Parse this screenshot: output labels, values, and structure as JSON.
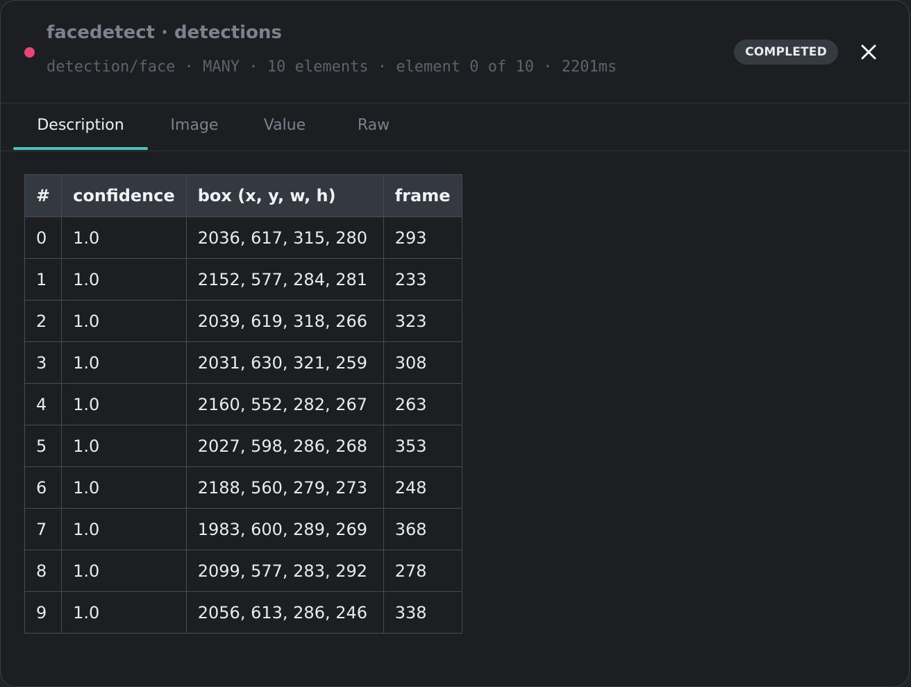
{
  "header": {
    "title": "facedetect · detections",
    "subtitle": "detection/face · MANY · 10 elements · element 0 of 10 · 2201ms",
    "status_badge": "COMPLETED",
    "status_dot_color": "#ea4577",
    "close_icon": "close-icon"
  },
  "tabs": [
    {
      "label": "Description",
      "active": true
    },
    {
      "label": "Image",
      "active": false
    },
    {
      "label": "Value",
      "active": false
    },
    {
      "label": "Raw",
      "active": false
    }
  ],
  "table": {
    "columns": [
      "#",
      "confidence",
      "box (x, y, w, h)",
      "frame"
    ],
    "rows": [
      [
        "0",
        "1.0",
        "2036, 617, 315, 280",
        "293"
      ],
      [
        "1",
        "1.0",
        "2152, 577, 284, 281",
        "233"
      ],
      [
        "2",
        "1.0",
        "2039, 619, 318, 266",
        "323"
      ],
      [
        "3",
        "1.0",
        "2031, 630, 321, 259",
        "308"
      ],
      [
        "4",
        "1.0",
        "2160, 552, 282, 267",
        "263"
      ],
      [
        "5",
        "1.0",
        "2027, 598, 286, 268",
        "353"
      ],
      [
        "6",
        "1.0",
        "2188, 560, 279, 273",
        "248"
      ],
      [
        "7",
        "1.0",
        "1983, 600, 289, 269",
        "368"
      ],
      [
        "8",
        "1.0",
        "2099, 577, 283, 292",
        "278"
      ],
      [
        "9",
        "1.0",
        "2056, 613, 286, 246",
        "338"
      ]
    ]
  },
  "colors": {
    "accent": "#45c4c0",
    "status_dot": "#ea4577",
    "background": "#1c1e22"
  }
}
